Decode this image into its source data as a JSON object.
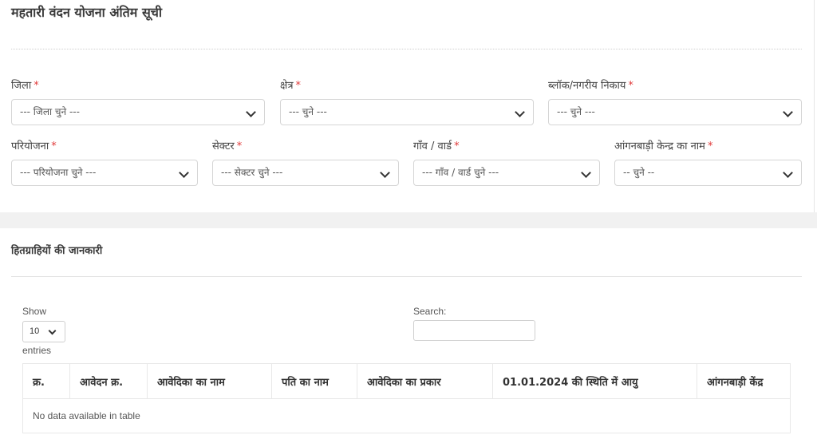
{
  "page": {
    "title": "महतारी वंदन योजना अंतिम सूची"
  },
  "filters": {
    "required_mark": "*",
    "district": {
      "label": "जिला",
      "value": "--- जिला चुने ---"
    },
    "area": {
      "label": "क्षेत्र",
      "value": "--- चुने ---"
    },
    "block": {
      "label": "ब्लॉक/नगरीय निकाय",
      "value": "--- चुने ---"
    },
    "project": {
      "label": "परियोजना",
      "value": "--- परियोजना चुने ---"
    },
    "sector": {
      "label": "सेक्टर",
      "value": "--- सेक्टर चुने ---"
    },
    "village": {
      "label": "गाँव / वार्ड",
      "value": "--- गाँव / वार्ड चुने ---"
    },
    "anganwadi": {
      "label": "आंगनबाड़ी केन्द्र का नाम",
      "value": "-- चुने --"
    }
  },
  "beneficiaries": {
    "section_title": "हितग्राहियों की जानकारी",
    "show_label": "Show",
    "page_length": "10",
    "entries_label": "entries",
    "search_label": "Search:",
    "search_value": "",
    "columns": [
      "क्र.",
      "आवेदन क्र.",
      "आवेदिका का नाम",
      "पति का नाम",
      "आवेदिका का प्रकार",
      "01.01.2024 की स्थिति में आयु",
      "आंगनबाड़ी केंद्र"
    ],
    "empty_message": "No data available in table"
  },
  "colors": {
    "required": "#e03a3a",
    "band": "#f1f1f1"
  }
}
